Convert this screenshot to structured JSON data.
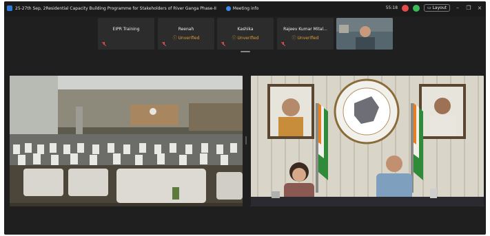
{
  "window": {
    "title": "25-27th Sep, 2Residential Capacity Building Programme for Stakeholders of River Ganga Phase-II",
    "meeting_info_label": "Meeting info",
    "timer": "55:18",
    "layout_label": "Layout"
  },
  "participants": [
    {
      "name": "EIPR Training",
      "status": ""
    },
    {
      "name": "Reenah",
      "status": "Unverified"
    },
    {
      "name": "Kashika",
      "status": "Unverified"
    },
    {
      "name": "Rajeev Kumar Mital...",
      "status": "Unverified"
    }
  ],
  "colors": {
    "window_bg": "#1f1f1f",
    "tile_bg": "#2c2c2c",
    "unverified": "#e2a035",
    "accent": "#3c8bf0"
  },
  "icons": [
    "shield-icon",
    "meeting-info-icon",
    "record-red-icon",
    "status-green-icon",
    "layout-icon",
    "minimize-icon",
    "restore-icon",
    "close-icon",
    "mic-muted-icon",
    "warning-icon"
  ]
}
